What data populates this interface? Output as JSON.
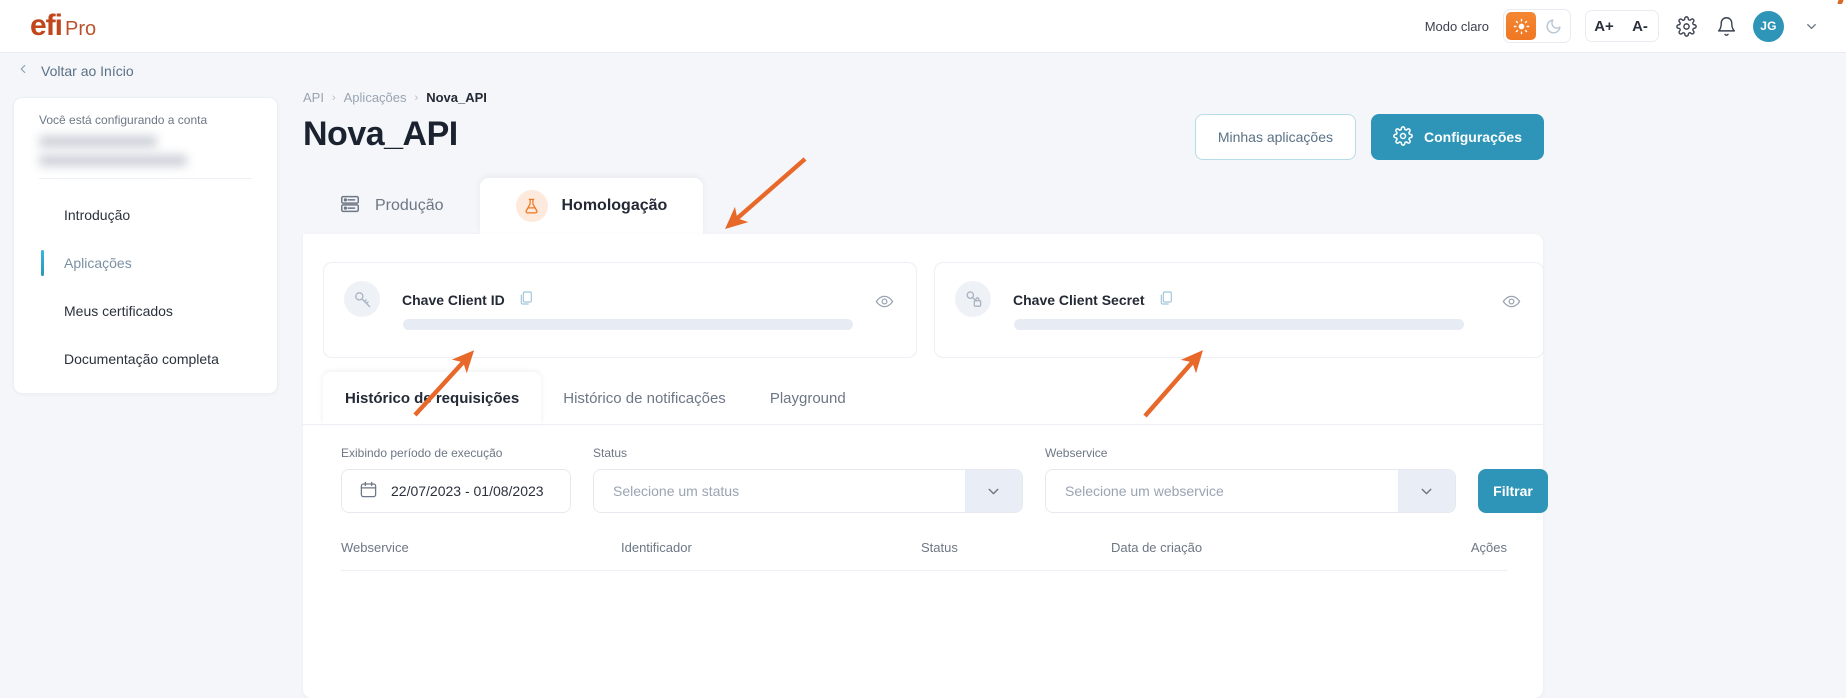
{
  "topbar": {
    "logo_main": "efi",
    "logo_sub": "Pro",
    "mode_label": "Modo claro",
    "sun_icon": "sun-icon",
    "moon_icon": "moon-icon",
    "font_increase": "A+",
    "font_decrease": "A-",
    "gear_icon": "gear-icon",
    "bell_icon": "bell-icon",
    "avatar_initials": "JG",
    "chevron_icon": "chevron-down-icon"
  },
  "back_link": {
    "label": "Voltar ao Início",
    "icon": "chevron-left-icon"
  },
  "sidebar": {
    "note": "Você está configurando a conta",
    "account_masked": true,
    "items": [
      {
        "label": "Introdução",
        "active": false
      },
      {
        "label": "Aplicações",
        "active": true
      },
      {
        "label": "Meus certificados",
        "active": false
      },
      {
        "label": "Documentação completa",
        "active": false
      }
    ]
  },
  "breadcrumb": [
    "API",
    "Aplicações",
    "Nova_API"
  ],
  "page_title": "Nova_API",
  "header_actions": {
    "my_apps_label": "Minhas aplicações",
    "settings_label": "Configurações",
    "settings_icon": "gear-icon"
  },
  "env_tabs": [
    {
      "label": "Produção",
      "icon": "server-icon",
      "active": false
    },
    {
      "label": "Homologação",
      "icon": "flask-icon",
      "active": true
    }
  ],
  "keys": [
    {
      "title": "Chave Client ID",
      "badge_icon": "key-icon",
      "copy_icon": "copy-icon",
      "reveal_icon": "eye-icon",
      "value_masked": true
    },
    {
      "title": "Chave Client Secret",
      "badge_icon": "key-lock-icon",
      "copy_icon": "copy-icon",
      "reveal_icon": "eye-icon",
      "value_masked": true
    }
  ],
  "inner_tabs": [
    {
      "label": "Histórico de requisições",
      "active": true
    },
    {
      "label": "Histórico de notificações",
      "active": false
    },
    {
      "label": "Playground",
      "active": false
    }
  ],
  "filters": {
    "date": {
      "label": "Exibindo período de execução",
      "value": "22/07/2023 - 01/08/2023",
      "icon": "calendar-icon"
    },
    "status": {
      "label": "Status",
      "placeholder": "Selecione um status",
      "value": "",
      "chevron": "chevron-down-icon"
    },
    "webservice": {
      "label": "Webservice",
      "placeholder": "Selecione um webservice",
      "value": "",
      "chevron": "chevron-down-icon"
    },
    "submit_label": "Filtrar"
  },
  "table": {
    "columns": [
      "Webservice",
      "Identificador",
      "Status",
      "Data de criação",
      "Ações"
    ],
    "rows": []
  },
  "colors": {
    "brand_orange": "#ef7722",
    "accent_teal": "#2e95b8",
    "annotation_arrow": "#e8682a",
    "page_bg": "#f4f6f9"
  },
  "annotations": [
    {
      "name": "arrow-to-homologacao-tab"
    },
    {
      "name": "arrow-to-client-id"
    },
    {
      "name": "arrow-to-client-secret"
    }
  ]
}
